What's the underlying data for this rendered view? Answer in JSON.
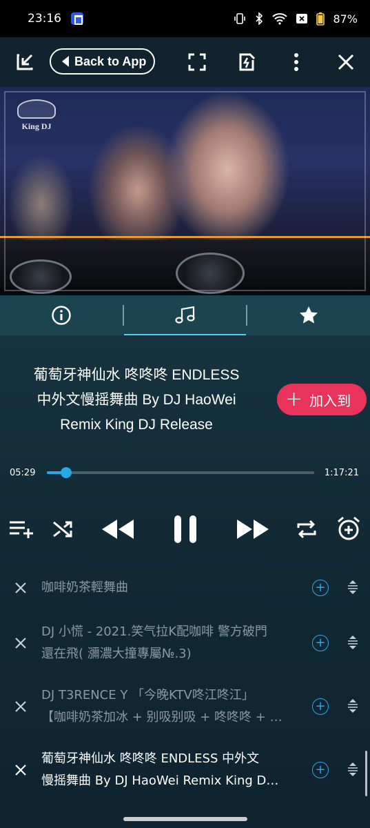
{
  "status_bar": {
    "time": "23:16",
    "battery": "87%"
  },
  "top_bar": {
    "back_label": "Back to App"
  },
  "video": {
    "logo_text": "King DJ"
  },
  "song": {
    "title_lines": [
      "葡萄牙神仙水  咚咚咚  ENDLESS",
      "中外文慢摇舞曲 By DJ HaoWei",
      "Remix King DJ Release"
    ],
    "add_label": "加入到"
  },
  "player": {
    "current_time": "05:29",
    "total_time": "1:17:21",
    "progress": 0.071
  },
  "playlist": [
    {
      "line1": "咖啡奶茶輕舞曲",
      "line2": ""
    },
    {
      "line1": "DJ 小慌 - 2021.笑气拉K配咖啡 警方破門",
      "line2": "還在飛( 瀰濃大撞專屬№.3)"
    },
    {
      "line1": "DJ T3RENCE Y 「今晚KTV咚江咚江」",
      "line2": "【咖啡奶茶加冰 + 别吸别吸 + 咚咚咚 + …"
    },
    {
      "line1": "葡萄牙神仙水  咚咚咚  ENDLESS  中外文",
      "line2": "慢摇舞曲 By DJ HaoWei Remix King D…"
    }
  ],
  "colors": {
    "accent": "#29a8e6",
    "add_button": "#e8345a",
    "tab_bar": "#1c4450",
    "active_tab_line": "#4fd3e8",
    "progress_line": "#e89a2a"
  }
}
